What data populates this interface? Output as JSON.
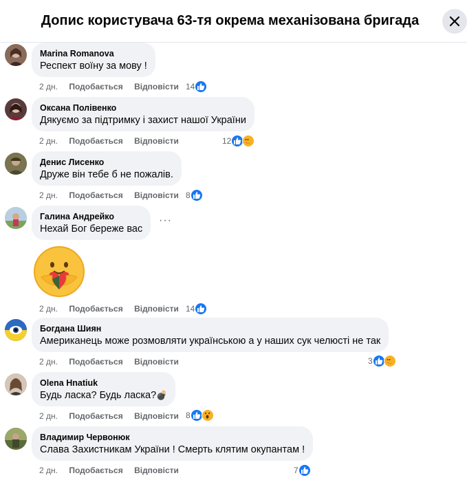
{
  "header": {
    "title": "Допис користувача 63-тя окрема механізована бригада"
  },
  "comments": [
    {
      "author": "Marina Romanova",
      "text": "Респект воїну за мову !",
      "time": "2 дн.",
      "like": "Подобається",
      "reply": "Відповісти",
      "count": "14",
      "reactions": [
        "like"
      ]
    },
    {
      "author": "Оксана Полівенко",
      "text": "Дякуємо за підтримку і захист нашої України",
      "time": "2 дн.",
      "like": "Подобається",
      "reply": "Відповісти",
      "count": "12",
      "reactions": [
        "like",
        "care"
      ]
    },
    {
      "author": "Денис Лисенко",
      "text": "Друже він тебе б не пожалів.",
      "time": "2 дн.",
      "like": "Подобається",
      "reply": "Відповісти",
      "count": "8",
      "reactions": [
        "like"
      ]
    },
    {
      "author": "Галина Андрейко",
      "text": "Нехай Бог береже вас",
      "time": "2 дн.",
      "like": "Подобається",
      "reply": "Відповісти",
      "count": "14",
      "reactions": [
        "like"
      ],
      "more": "···",
      "sticker": "care-sticker"
    },
    {
      "author": "Богдана Шиян",
      "text": "Американець може розмовляти українською а у наших сук челюсті не так",
      "time": "2 дн.",
      "like": "Подобається",
      "reply": "Відповісти",
      "count": "3",
      "reactions": [
        "like",
        "care"
      ]
    },
    {
      "author": "Olena Hnatiuk",
      "text": "Будь ласка? Будь ласка?",
      "emoji": "💣",
      "time": "2 дн.",
      "like": "Подобається",
      "reply": "Відповісти",
      "count": "8",
      "reactions": [
        "like",
        "wow"
      ]
    },
    {
      "author": "Владимир Червонюк",
      "text": "Слава Захистникам України ! Смерть клятим окупантам !",
      "time": "2 дн.",
      "like": "Подобається",
      "reply": "Відповісти",
      "count": "7",
      "reactions": [
        "like"
      ]
    }
  ],
  "colors": {
    "like": "#1877f2",
    "bubble": "#f0f2f5",
    "muted": "#65676b"
  }
}
